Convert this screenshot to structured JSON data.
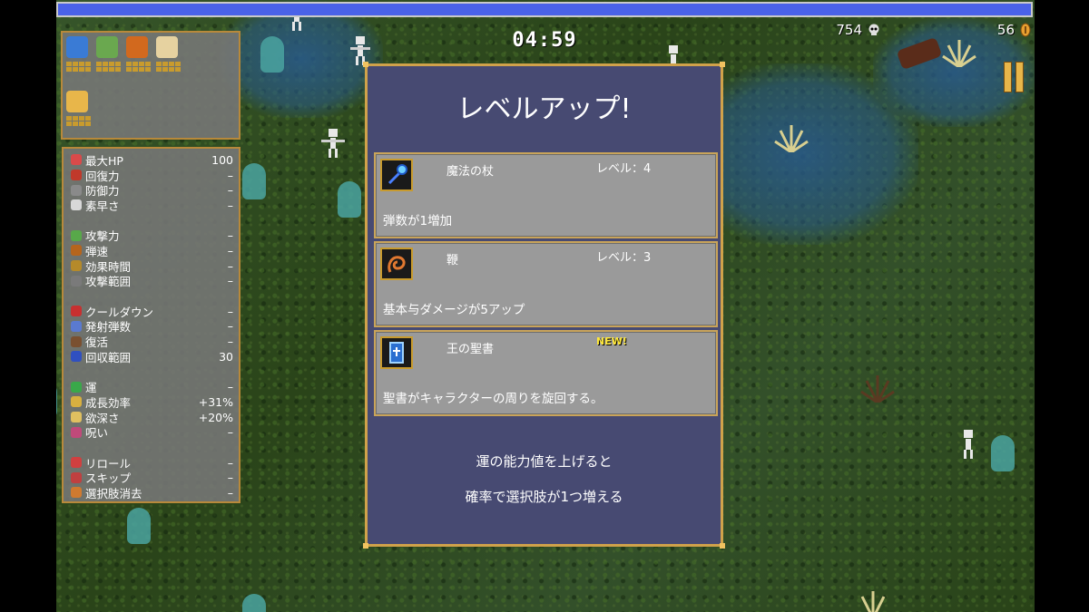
{
  "hud": {
    "timer": "04:59",
    "kills": "754",
    "coins": "56",
    "xp_progress": 1.0
  },
  "weapons": [
    {
      "icon": "magic-wand-icon",
      "color": "#3a7bd5"
    },
    {
      "icon": "herb-icon",
      "color": "#6aa84f"
    },
    {
      "icon": "whip-icon",
      "color": "#d2691e"
    },
    {
      "icon": "garlic-icon",
      "color": "#e6d2a0"
    },
    {
      "icon": "crown-icon",
      "color": "#e8b64a"
    }
  ],
  "stats": {
    "groups": [
      [
        {
          "icon": "heart-icon",
          "label": "最大HP",
          "value": "100"
        },
        {
          "icon": "recovery-icon",
          "label": "回復力",
          "value": "–"
        },
        {
          "icon": "armor-icon",
          "label": "防御力",
          "value": "–"
        },
        {
          "icon": "wing-icon",
          "label": "素早さ",
          "value": "–"
        }
      ],
      [
        {
          "icon": "might-icon",
          "label": "攻撃力",
          "value": "–"
        },
        {
          "icon": "speed-icon",
          "label": "弾速",
          "value": "–"
        },
        {
          "icon": "duration-icon",
          "label": "効果時間",
          "value": "–"
        },
        {
          "icon": "area-icon",
          "label": "攻撃範囲",
          "value": "–"
        }
      ],
      [
        {
          "icon": "cooldown-icon",
          "label": "クールダウン",
          "value": "–"
        },
        {
          "icon": "amount-icon",
          "label": "発射弾数",
          "value": "–"
        },
        {
          "icon": "revival-icon",
          "label": "復活",
          "value": "–"
        },
        {
          "icon": "magnet-icon",
          "label": "回収範囲",
          "value": "30"
        }
      ],
      [
        {
          "icon": "clover-icon",
          "label": "運",
          "value": "–"
        },
        {
          "icon": "growth-icon",
          "label": "成長効率",
          "value": "+31%"
        },
        {
          "icon": "greed-icon",
          "label": "欲深さ",
          "value": "+20%"
        },
        {
          "icon": "curse-icon",
          "label": "呪い",
          "value": "–"
        }
      ],
      [
        {
          "icon": "reroll-icon",
          "label": "リロール",
          "value": "–"
        },
        {
          "icon": "skip-icon",
          "label": "スキップ",
          "value": "–"
        },
        {
          "icon": "banish-icon",
          "label": "選択肢消去",
          "value": "–"
        }
      ]
    ]
  },
  "levelup": {
    "title": "レベルアップ!",
    "options": [
      {
        "icon": "magic-wand-icon",
        "name": "魔法の杖",
        "level": "レベル：4",
        "is_new": false,
        "description": "弾数が1増加"
      },
      {
        "icon": "whip-icon",
        "name": "鞭",
        "level": "レベル：3",
        "is_new": false,
        "description": "基本与ダメージが5アップ"
      },
      {
        "icon": "king-bible-icon",
        "name": "王の聖書",
        "new_label": "NEW!",
        "is_new": true,
        "description": "聖書がキャラクターの周りを旋回する。"
      }
    ],
    "hint_line1": "運の能力値を上げると",
    "hint_line2": "確率で選択肢が1つ増える"
  },
  "colors": {
    "modal_bg": "#474a72",
    "border_gold": "#d0a24a",
    "option_bg": "#9a9a9a",
    "xp_bar": "#4a62e8",
    "new_badge": "#ffe83a"
  }
}
